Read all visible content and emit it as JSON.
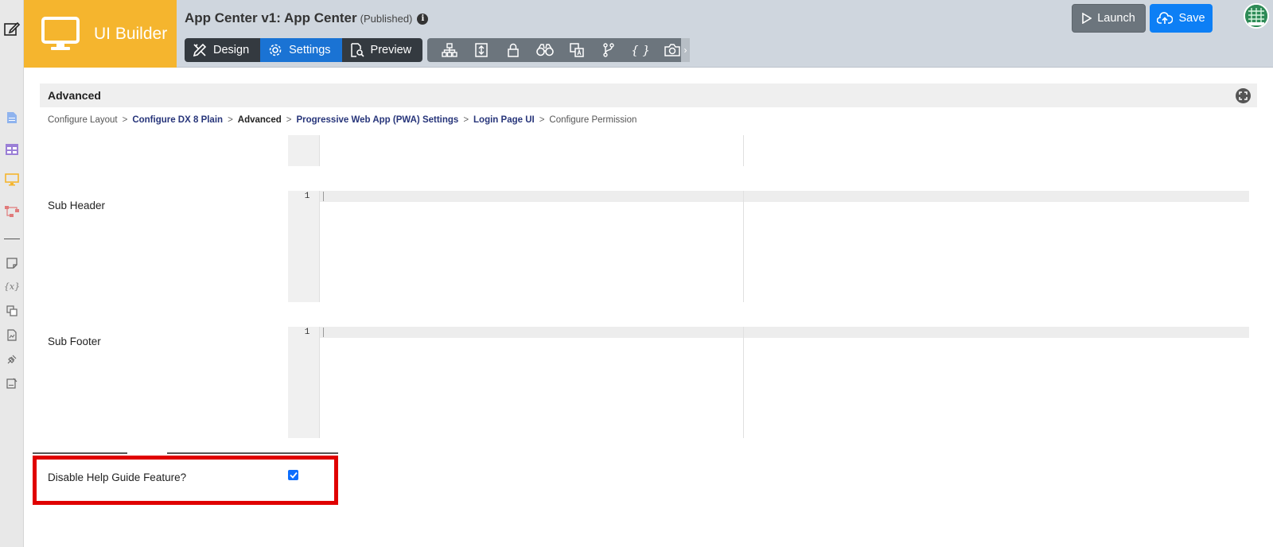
{
  "app": {
    "brand_name": "UI Builder",
    "title": "App Center v1: App Center",
    "status": "(Published)"
  },
  "modes": [
    {
      "label": "Design",
      "active": false
    },
    {
      "label": "Settings",
      "active": true
    },
    {
      "label": "Preview",
      "active": false
    }
  ],
  "toolbar": {
    "icons": [
      "sitemap-icon",
      "layout-icon",
      "lock-icon",
      "binoculars-icon",
      "translate-icon",
      "branch-icon",
      "braces-icon",
      "camera-icon"
    ],
    "braces_text": "{ }",
    "more_arrow": "›"
  },
  "actions": {
    "launch_label": "Launch",
    "save_label": "Save"
  },
  "panel": {
    "title": "Advanced"
  },
  "breadcrumb": [
    {
      "label": "Configure Layout",
      "kind": "plain"
    },
    {
      "label": "Configure DX 8 Plain",
      "kind": "link"
    },
    {
      "label": "Advanced",
      "kind": "current"
    },
    {
      "label": "Progressive Web App (PWA) Settings",
      "kind": "link"
    },
    {
      "label": "Login Page UI",
      "kind": "link"
    },
    {
      "label": "Configure Permission",
      "kind": "plain"
    }
  ],
  "breadcrumb_sep": ">",
  "fields": {
    "sub_header": {
      "label": "Sub Header",
      "line_number": "1"
    },
    "sub_footer": {
      "label": "Sub Footer",
      "line_number": "1"
    },
    "disable_help": {
      "label": "Disable Help Guide Feature?",
      "checked": true
    }
  },
  "sidebar_rail": {
    "vars_glyph": "{x}"
  },
  "colors": {
    "brand": "#f5b52e",
    "active_mode": "#1a73d4",
    "save": "#0d7ff5",
    "highlight": "#e00000"
  }
}
